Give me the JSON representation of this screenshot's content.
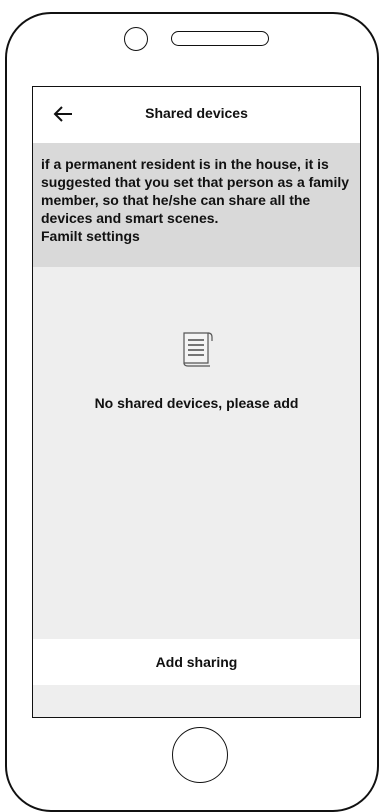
{
  "header": {
    "title": "Shared devices",
    "back_icon": "arrow-left-icon"
  },
  "notice": {
    "text": "if a permanent resident is in the house, it is suggested that you set that person as a family member, so that he/she can share all the devices and smart scenes.",
    "link": "Familt settings"
  },
  "empty_state": {
    "icon": "document-scroll-icon",
    "message": "No shared devices, please add"
  },
  "actions": {
    "add_sharing": "Add sharing"
  }
}
